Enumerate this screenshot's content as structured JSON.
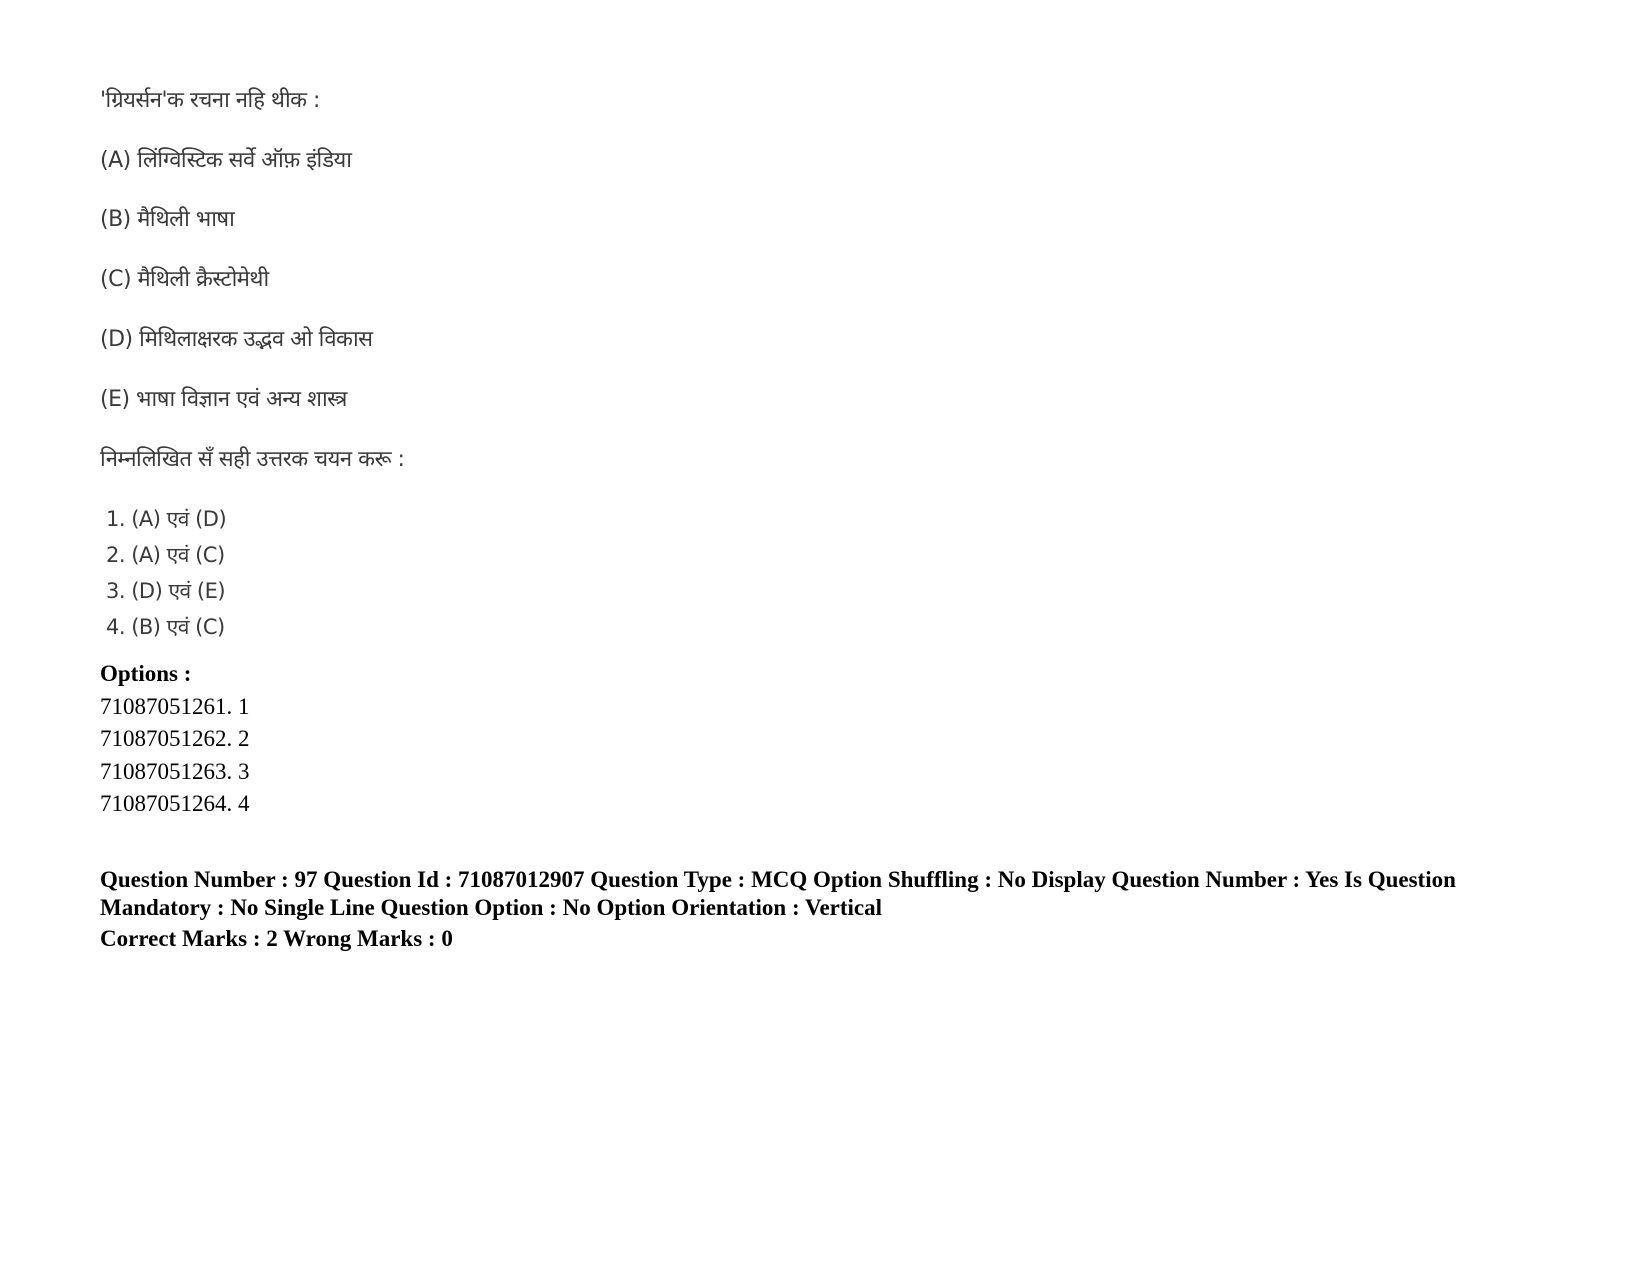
{
  "question": {
    "stem": "'ग्रियर्सन'क रचना नहि थीक :",
    "statements": [
      "(A) लिंग्विस्टिक सर्वे ऑफ़ इंडिया",
      "(B) मैथिली भाषा",
      "(C) मैथिली क्रैस्टोमेथी",
      "(D) मिथिलाक्षरक उद्भव ओ विकास",
      "(E) भाषा विज्ञान एवं अन्य शास्त्र"
    ],
    "instruction": "निम्नलिखित सँ सही उत्तरक चयन करू :",
    "choices": [
      "1. (A) एवं (D)",
      "2. (A) एवं (C)",
      "3. (D) एवं (E)",
      "4. (B) एवं (C)"
    ]
  },
  "options": {
    "heading": "Options :",
    "items": [
      "71087051261. 1",
      "71087051262. 2",
      "71087051263. 3",
      "71087051264. 4"
    ]
  },
  "next_question": {
    "meta_line": "Question Number : 97 Question Id : 71087012907 Question Type : MCQ Option Shuffling : No Display Question Number : Yes Is Question Mandatory : No Single Line Question Option : No Option Orientation : Vertical",
    "marks_line": "Correct Marks : 2 Wrong Marks : 0"
  }
}
